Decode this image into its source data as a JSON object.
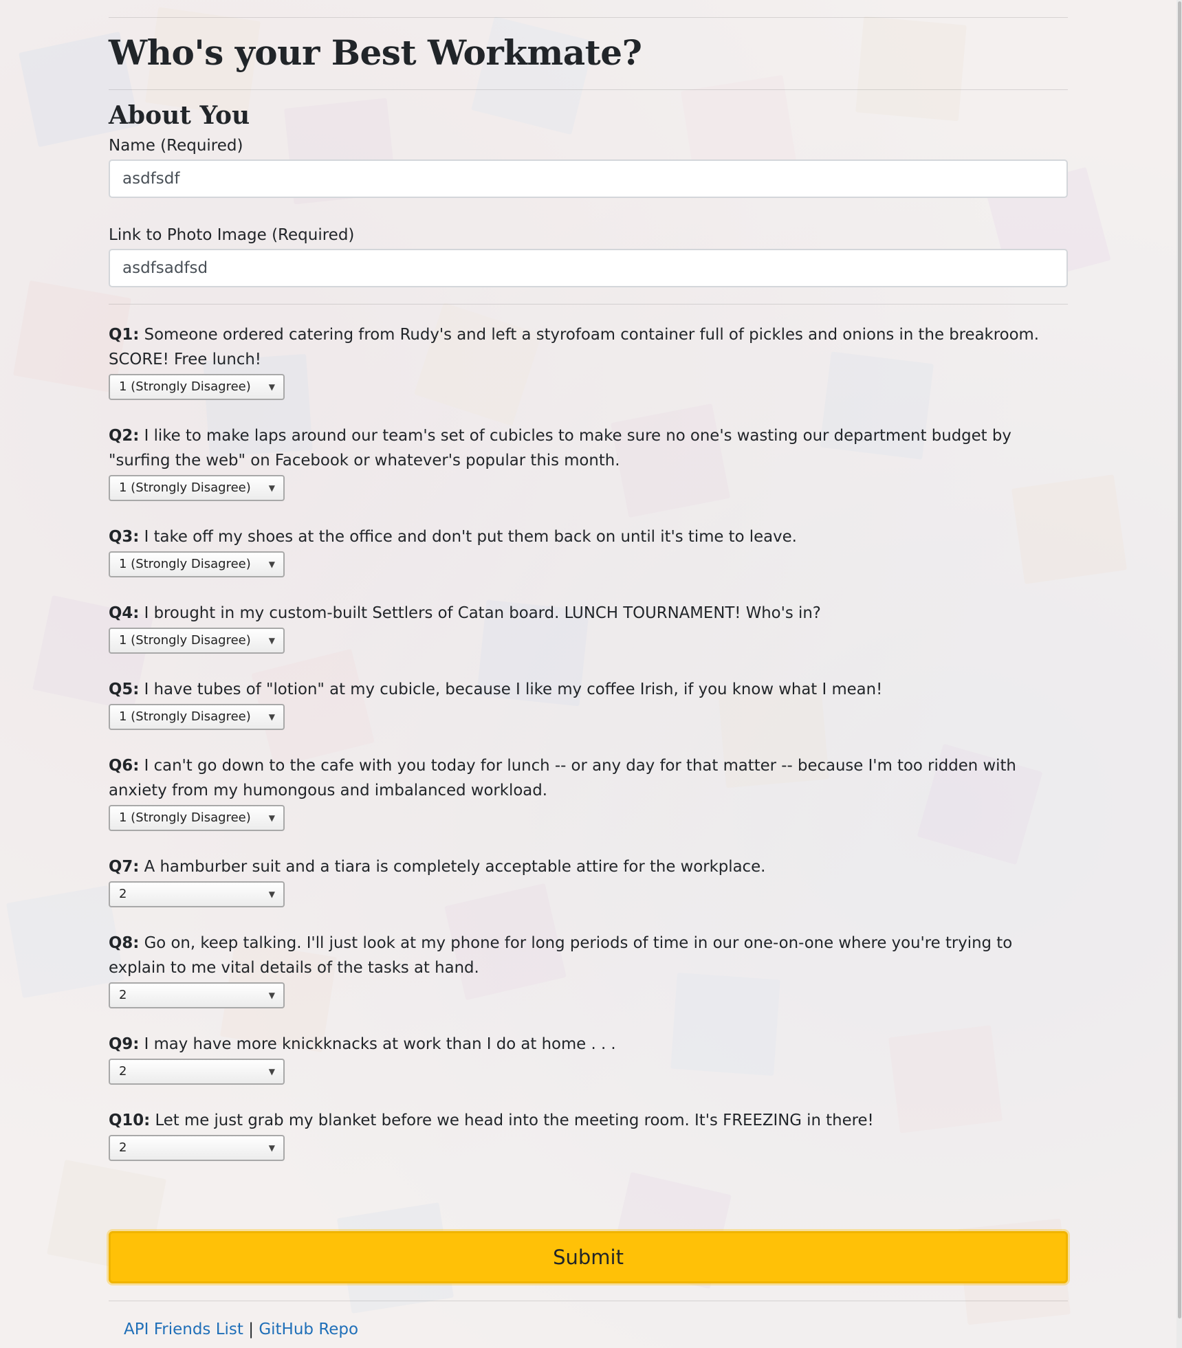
{
  "page": {
    "title": "Who's your Best Workmate?",
    "section_title": "About You"
  },
  "about": {
    "name_label": "Name (Required)",
    "name_value": "asdfsdf",
    "photo_label": "Link to Photo Image (Required)",
    "photo_value": "asdfsadfsd"
  },
  "questions": [
    {
      "num": "Q1:",
      "text": " Someone ordered catering from Rudy's and left a styrofoam container full of pickles and onions in the breakroom. SCORE! Free lunch!",
      "answer": "1 (Strongly Disagree)"
    },
    {
      "num": "Q2:",
      "text": " I like to make laps around our team's set of cubicles to make sure no one's wasting our department budget by \"surfing the web\" on Facebook or whatever's popular this month.",
      "answer": "1 (Strongly Disagree)"
    },
    {
      "num": "Q3:",
      "text": " I take off my shoes at the office and don't put them back on until it's time to leave.",
      "answer": "1 (Strongly Disagree)"
    },
    {
      "num": "Q4:",
      "text": " I brought in my custom-built Settlers of Catan board. LUNCH TOURNAMENT! Who's in?",
      "answer": "1 (Strongly Disagree)"
    },
    {
      "num": "Q5:",
      "text": " I have tubes of \"lotion\" at my cubicle, because I like my coffee Irish, if you know what I mean!",
      "answer": "1 (Strongly Disagree)"
    },
    {
      "num": "Q6:",
      "text": " I can't go down to the cafe with you today for lunch -- or any day for that matter -- because I'm too ridden with anxiety from my humongous and imbalanced workload.",
      "answer": "1 (Strongly Disagree)"
    },
    {
      "num": "Q7:",
      "text": " A hamburber suit and a tiara is completely acceptable attire for the workplace.",
      "answer": "2"
    },
    {
      "num": "Q8:",
      "text": " Go on, keep talking. I'll just look at my phone for long periods of time in our one-on-one where you're trying to explain to me vital details of the tasks at hand.",
      "answer": "2"
    },
    {
      "num": "Q9:",
      "text": " I may have more knickknacks at work than I do at home . . .",
      "answer": "2"
    },
    {
      "num": "Q10:",
      "text": " Let me just grab my blanket before we head into the meeting room. It's FREEZING in there!",
      "answer": "2"
    }
  ],
  "submit_label": "Submit",
  "footer": {
    "link1": "API Friends List",
    "separator": " | ",
    "link2": "GitHub Repo"
  },
  "colors": {
    "submit": "#ffc107",
    "link": "#1f6fb8"
  }
}
